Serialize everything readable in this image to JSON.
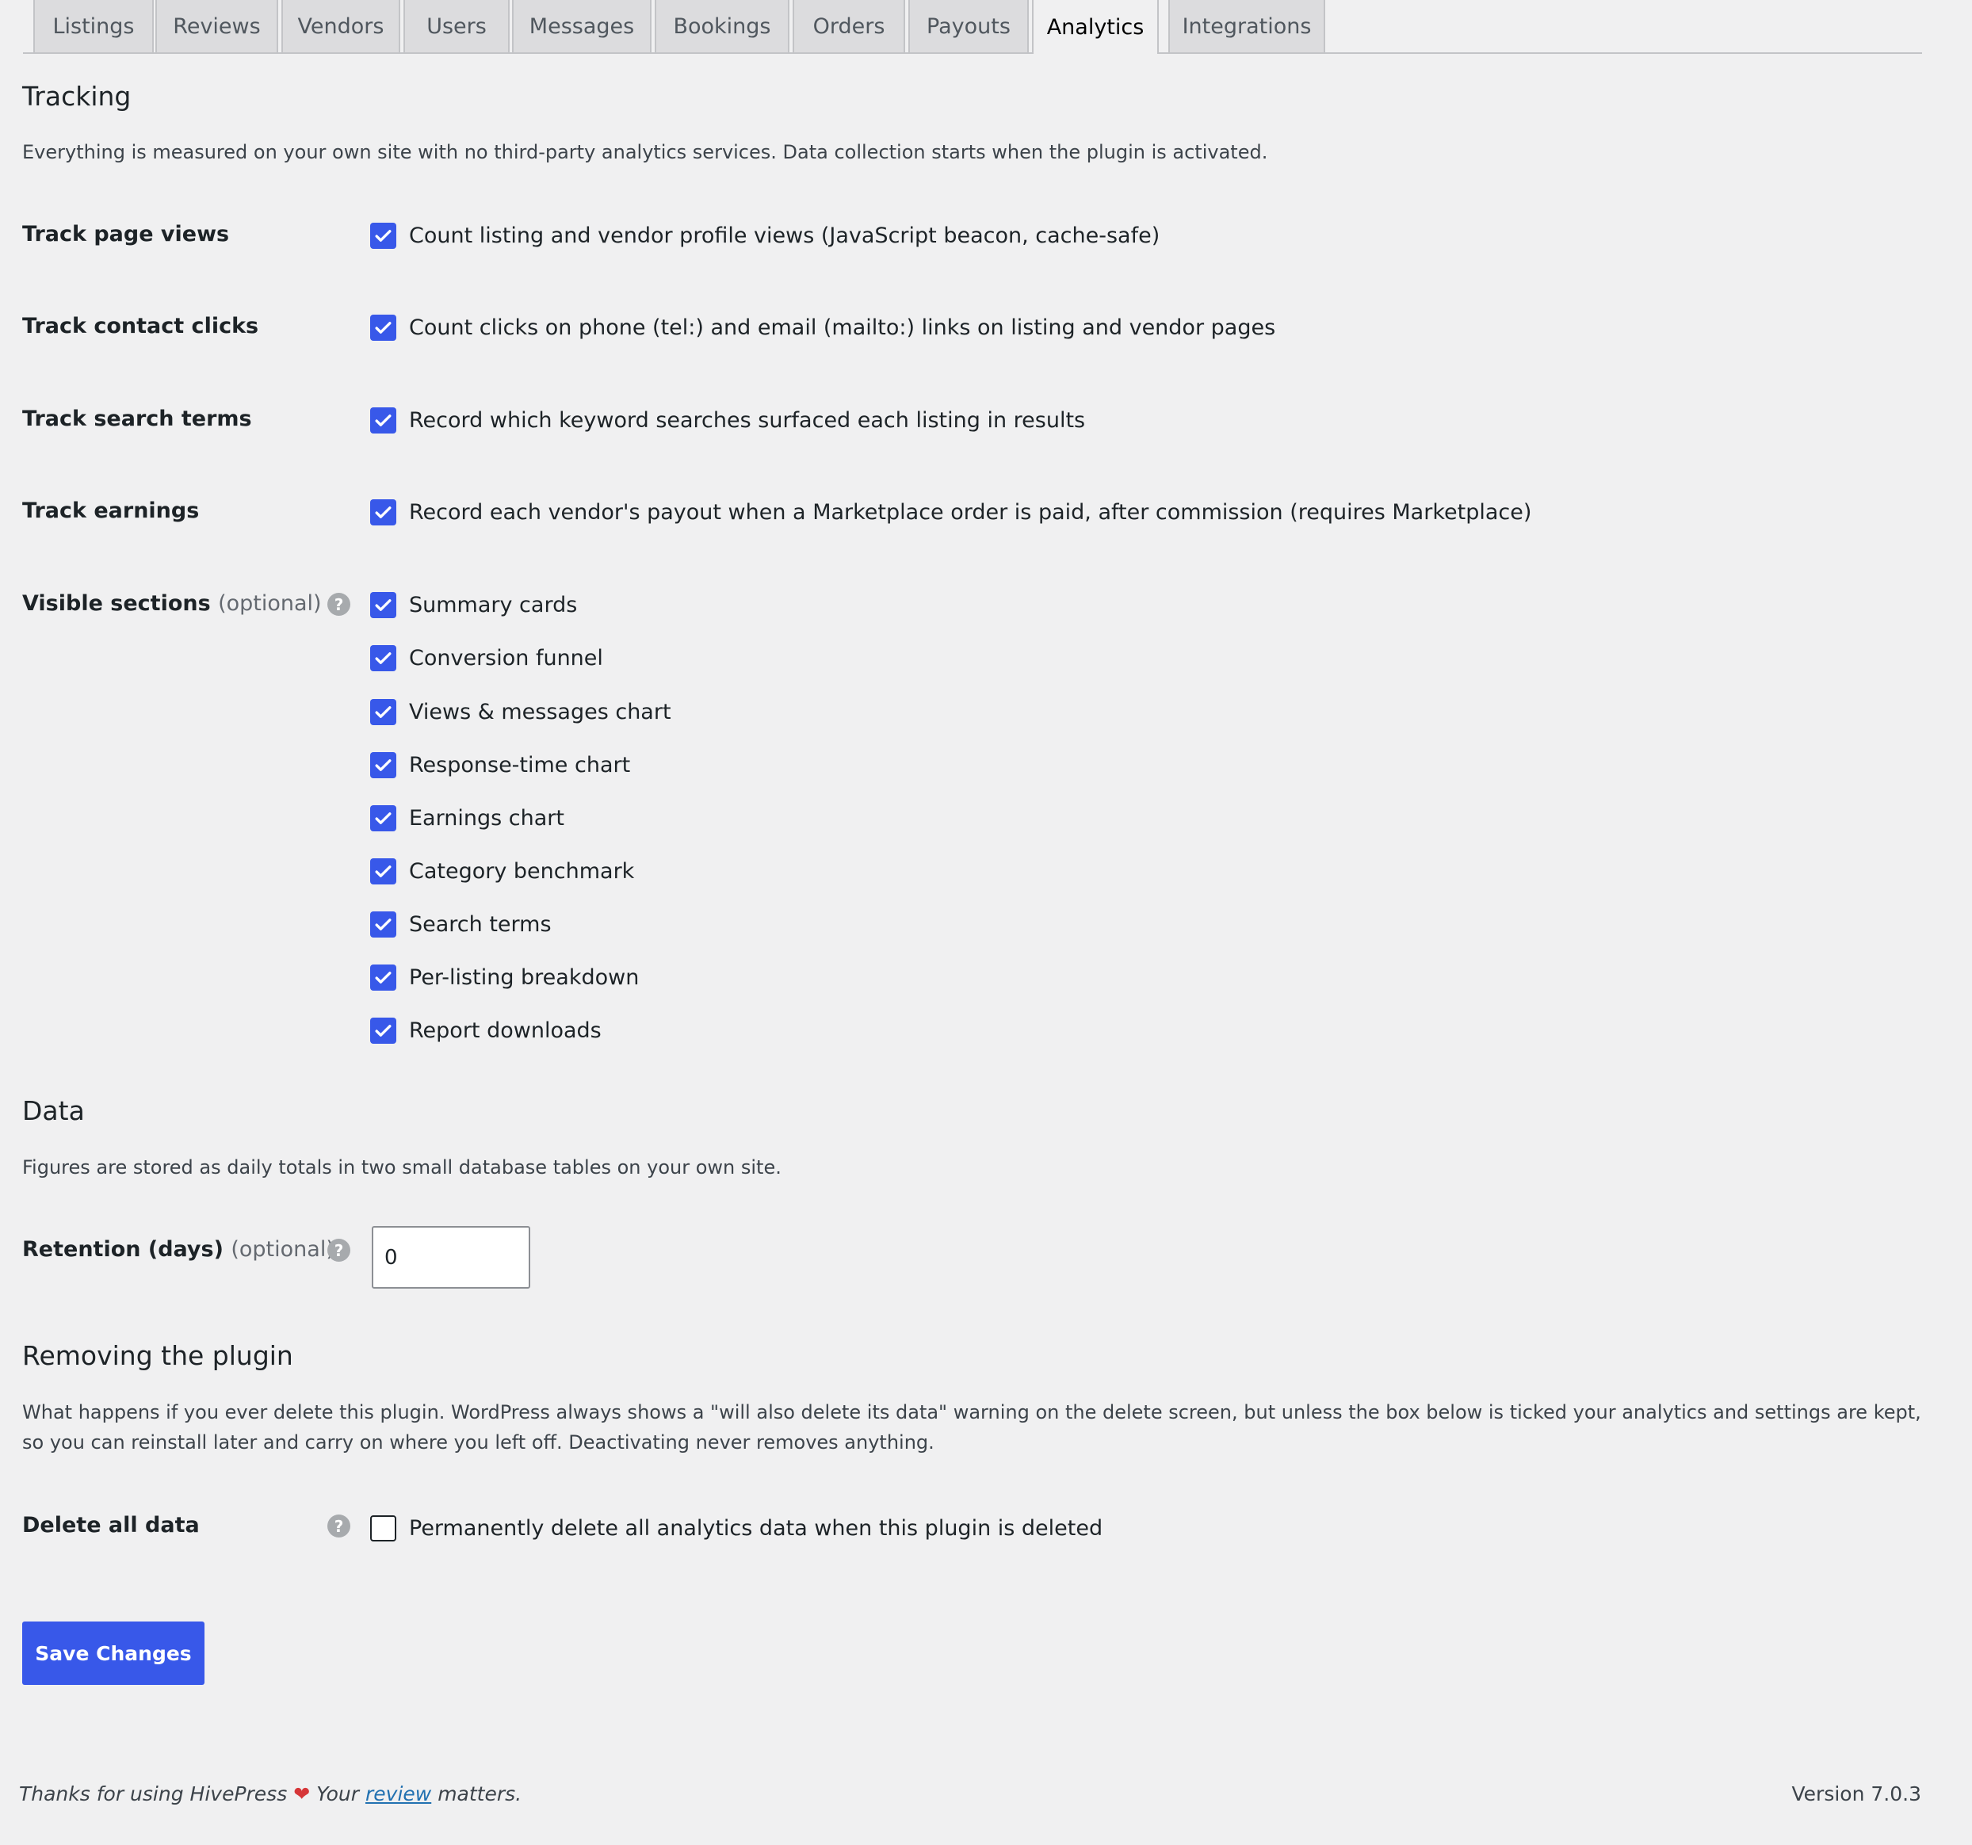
{
  "tabs": [
    {
      "label": "Listings",
      "active": false
    },
    {
      "label": "Reviews",
      "active": false
    },
    {
      "label": "Vendors",
      "active": false
    },
    {
      "label": "Users",
      "active": false
    },
    {
      "label": "Messages",
      "active": false
    },
    {
      "label": "Bookings",
      "active": false
    },
    {
      "label": "Orders",
      "active": false
    },
    {
      "label": "Payouts",
      "active": false
    },
    {
      "label": "Analytics",
      "active": true
    },
    {
      "label": "Integrations",
      "active": false
    }
  ],
  "tracking": {
    "heading": "Tracking",
    "description": "Everything is measured on your own site with no third-party analytics services. Data collection starts when the plugin is activated.",
    "rows": [
      {
        "label": "Track page views",
        "option": "Count listing and vendor profile views (JavaScript beacon, cache-safe)",
        "checked": true
      },
      {
        "label": "Track contact clicks",
        "option": "Count clicks on phone (tel:) and email (mailto:) links on listing and vendor pages",
        "checked": true
      },
      {
        "label": "Track search terms",
        "option": "Record which keyword searches surfaced each listing in results",
        "checked": true
      },
      {
        "label": "Track earnings",
        "option": "Record each vendor's payout when a Marketplace order is paid, after commission (requires Marketplace)",
        "checked": true
      }
    ],
    "visible_sections": {
      "label": "Visible sections",
      "optional": "(optional)",
      "help": "?",
      "options": [
        {
          "label": "Summary cards",
          "checked": true
        },
        {
          "label": "Conversion funnel",
          "checked": true
        },
        {
          "label": "Views & messages chart",
          "checked": true
        },
        {
          "label": "Response-time chart",
          "checked": true
        },
        {
          "label": "Earnings chart",
          "checked": true
        },
        {
          "label": "Category benchmark",
          "checked": true
        },
        {
          "label": "Search terms",
          "checked": true
        },
        {
          "label": "Per-listing breakdown",
          "checked": true
        },
        {
          "label": "Report downloads",
          "checked": true
        }
      ]
    }
  },
  "data_section": {
    "heading": "Data",
    "description": "Figures are stored as daily totals in two small database tables on your own site.",
    "retention_label": "Retention (days)",
    "retention_optional": "(optional)",
    "retention_help": "?",
    "retention_value": "0"
  },
  "removing": {
    "heading": "Removing the plugin",
    "description": "What happens if you ever delete this plugin. WordPress always shows a \"will also delete its data\" warning on the delete screen, but unless the box below is ticked your analytics and settings are kept, so you can reinstall later and carry on where you left off. Deactivating never removes anything.",
    "delete_label": "Delete all data",
    "delete_help": "?",
    "delete_option": "Permanently delete all analytics data when this plugin is deleted",
    "delete_checked": false
  },
  "save_label": "Save Changes",
  "footer": {
    "thanks": "Thanks for using HivePress",
    "heart": "❤",
    "your": "Your",
    "review_link": "review",
    "matters": "matters.",
    "version": "Version 7.0.3"
  },
  "colors": {
    "accent": "#3858e9",
    "background": "#f0f0f1",
    "heart": "#d63638"
  }
}
